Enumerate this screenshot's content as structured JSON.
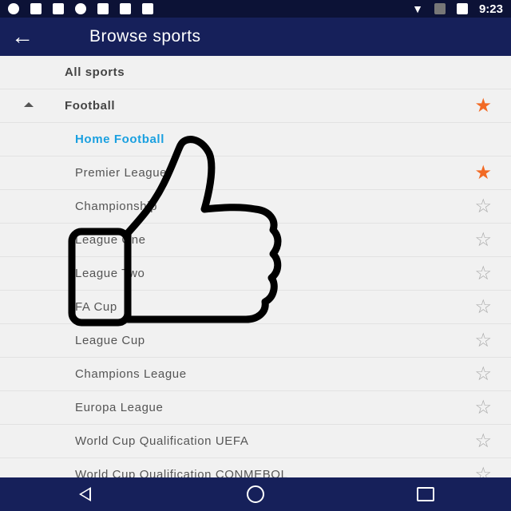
{
  "status_bar": {
    "time": "9:23",
    "icons": [
      "headset-icon",
      "wolf-icon",
      "facebook-icon",
      "info-icon",
      "lock-icon",
      "briefcase-icon",
      "robot-icon",
      "wifi-icon",
      "no-signal-icon",
      "battery-charging-icon"
    ]
  },
  "toolbar": {
    "title": "Browse sports",
    "back_icon": "arrow-left-icon"
  },
  "list": {
    "all_sports": "All sports",
    "football": {
      "label": "Football",
      "favorite": true,
      "expanded": true
    },
    "items": [
      {
        "label": "Home Football",
        "active": true,
        "favorite": null
      },
      {
        "label": "Premier League",
        "favorite": true
      },
      {
        "label": "Championship",
        "favorite": false
      },
      {
        "label": "League One",
        "favorite": false
      },
      {
        "label": "League Two",
        "favorite": false
      },
      {
        "label": "FA Cup",
        "favorite": false
      },
      {
        "label": "League Cup",
        "favorite": false
      },
      {
        "label": "Champions League",
        "favorite": false
      },
      {
        "label": "Europa League",
        "favorite": false
      },
      {
        "label": "World Cup Qualification UEFA",
        "favorite": false
      },
      {
        "label": "World Cup Qualification CONMEBOL",
        "favorite": false
      }
    ]
  },
  "navbar": {
    "back": "back-triangle-icon",
    "home": "home-circle-icon",
    "recents": "recents-square-icon"
  },
  "overlay": {
    "icon": "thumbs-up-icon"
  },
  "colors": {
    "primary": "#16205a",
    "status": "#0c1236",
    "accent": "#1aa0e0",
    "star": "#f26a24"
  }
}
